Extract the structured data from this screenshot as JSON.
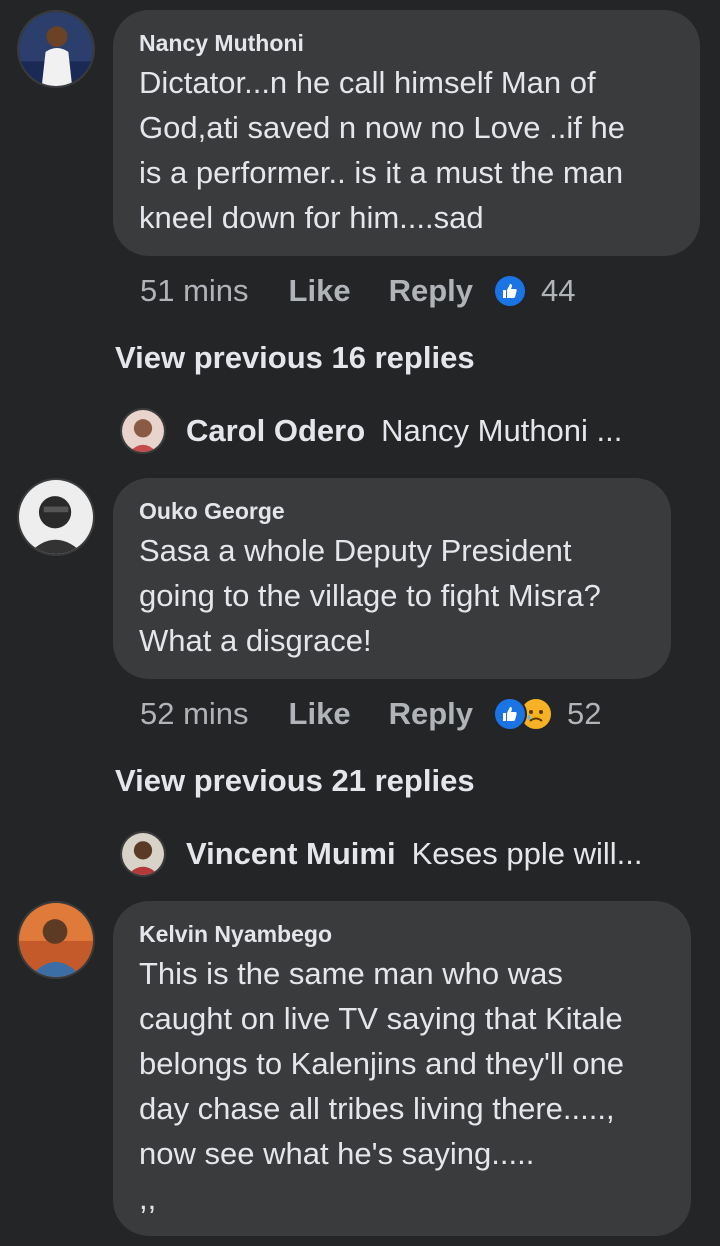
{
  "comments": [
    {
      "author": "Nancy Muthoni",
      "lines": [
        "Dictator...n he call himself Man of",
        "God,ati saved n now no Love ..if he",
        "is a performer.. is it a must the man",
        "kneel down for him....sad"
      ],
      "time": "51 mins",
      "like_label": "Like",
      "reply_label": "Reply",
      "reaction_icons": [
        "like-icon"
      ],
      "reaction_count": "44",
      "view_previous": "View previous 16 replies",
      "latest_reply": {
        "name": "Carol Odero",
        "preview": "Nancy Muthoni ..."
      }
    },
    {
      "author": "Ouko George",
      "lines": [
        "Sasa a whole Deputy President",
        "going to the village to fight Misra?",
        "What a disgrace!"
      ],
      "time": "52 mins",
      "like_label": "Like",
      "reply_label": "Reply",
      "reaction_icons": [
        "like-icon",
        "sad-icon"
      ],
      "reaction_count": "52",
      "view_previous": "View previous 21 replies",
      "latest_reply": {
        "name": "Vincent Muimi",
        "preview": "Keses pple will..."
      }
    },
    {
      "author": "Kelvin Nyambego",
      "lines": [
        "This is the same man who was",
        "caught on live TV saying that Kitale",
        "belongs to Kalenjins and they'll one",
        "day chase all tribes living there.....,",
        "now see what he's saying.....",
        ",,"
      ]
    }
  ],
  "colors": {
    "background": "#242526",
    "bubble": "#3a3b3c",
    "primary_text": "#e4e6eb",
    "secondary_text": "#b0b3b8",
    "like_blue": "#1b74e4",
    "sad_yellow": "#f7b125"
  }
}
